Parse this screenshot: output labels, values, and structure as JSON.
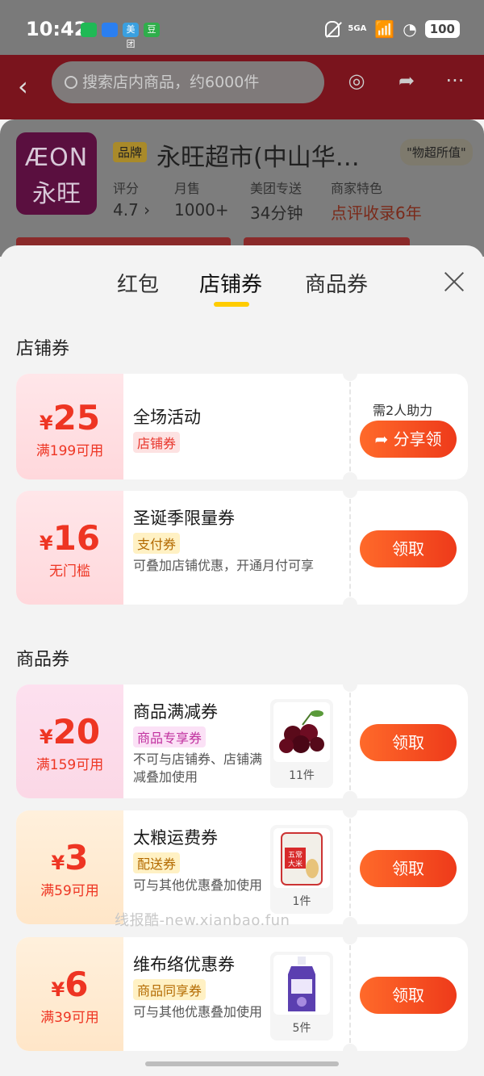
{
  "status": {
    "time": "10:42",
    "apps": [
      "",
      "",
      "美团",
      "豆"
    ],
    "signal": "5GA",
    "battery": "100"
  },
  "nav": {
    "search_placeholder": "搜索店内商品，约6000件"
  },
  "store": {
    "logo_line1": "ÆON",
    "logo_line2": "永旺",
    "brand_tag": "品牌",
    "name": "永旺超市(中山华…",
    "slogan": "\"物超所值\"",
    "metrics": [
      {
        "label": "评分",
        "value": "4.7 ›"
      },
      {
        "label": "月售",
        "value": "1000+"
      },
      {
        "label": "美团专送",
        "value": "34分钟"
      },
      {
        "label": "商家特色",
        "value": "点评收录6年"
      }
    ]
  },
  "tabs": [
    {
      "label": "红包"
    },
    {
      "label": "店铺券"
    },
    {
      "label": "商品券"
    }
  ],
  "sections": {
    "store_coupons": "店铺券",
    "product_coupons": "商品券"
  },
  "coupons": [
    {
      "yen": "¥",
      "amount": "25",
      "condition": "满199可用",
      "name": "全场活动",
      "tag": "店铺券",
      "desc": "",
      "help": "需2人助力",
      "button": "分享领"
    },
    {
      "yen": "¥",
      "amount": "16",
      "condition": "无门槛",
      "name": "圣诞季限量券",
      "tag": "支付券",
      "desc": "可叠加店铺优惠，开通月付可享",
      "button": "领取"
    },
    {
      "yen": "¥",
      "amount": "20",
      "condition": "满159可用",
      "name": "商品满减券",
      "tag": "商品专享券",
      "desc": "不可与店铺券、店铺满减叠加使用",
      "count": "11件",
      "button": "领取"
    },
    {
      "yen": "¥",
      "amount": "3",
      "condition": "满59可用",
      "name": "太粮运费券",
      "tag": "配送券",
      "desc": "可与其他优惠叠加使用",
      "count": "1件",
      "button": "领取"
    },
    {
      "yen": "¥",
      "amount": "6",
      "condition": "满39可用",
      "name": "维布络优惠券",
      "tag": "商品同享券",
      "desc": "可与其他优惠叠加使用",
      "count": "5件",
      "button": "领取"
    }
  ],
  "watermark": "线报酷-new.xianbao.fun",
  "colors": {
    "accent": "#ee3523",
    "tab_indicator": "#ffcc00",
    "button": "#ff5a22"
  }
}
